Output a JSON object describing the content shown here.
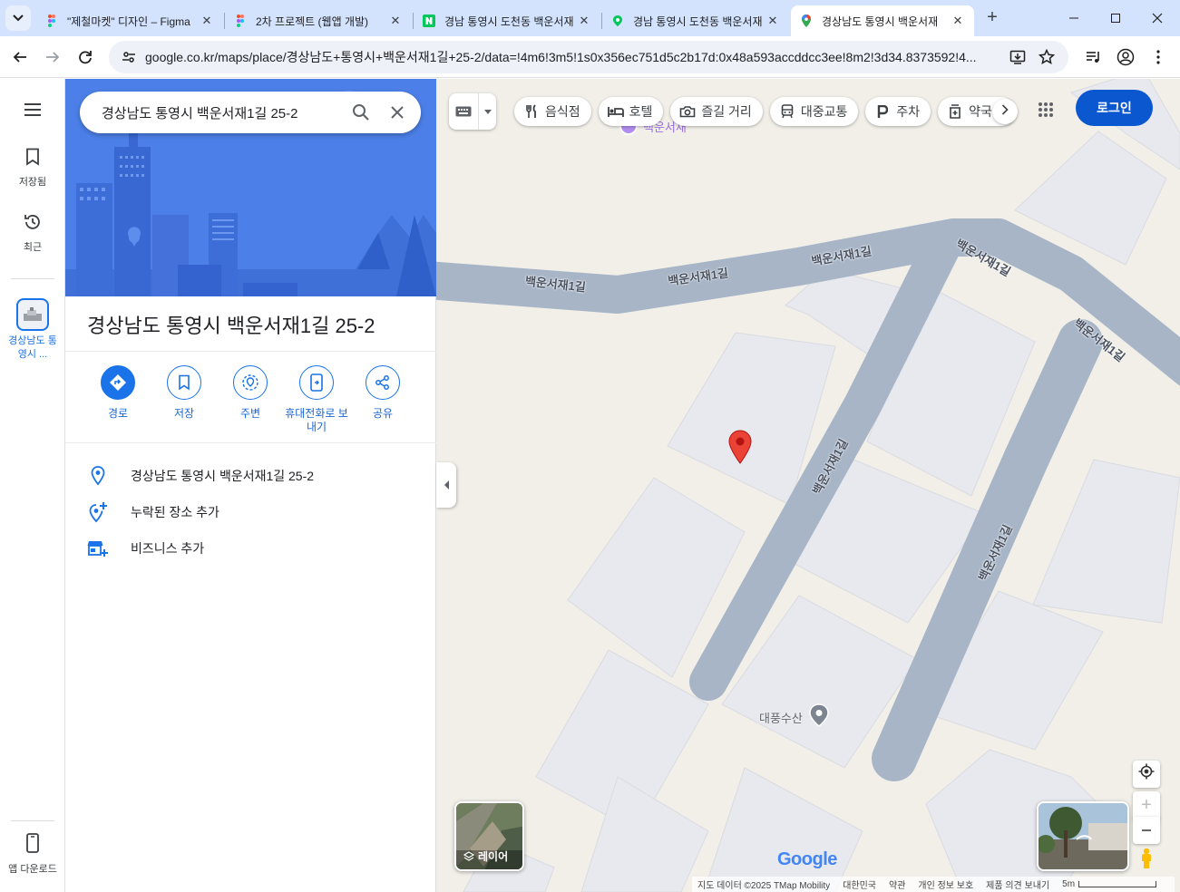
{
  "browser": {
    "tabs": [
      {
        "title": "\"제철마켓\" 디자인 – Figma",
        "favicon": "figma-icon",
        "active": false
      },
      {
        "title": "2차 프로젝트 (웹앱 개발)",
        "favicon": "figma-icon",
        "active": false
      },
      {
        "title": "경남 통영시 도천동 백운서재",
        "favicon": "naver-icon",
        "active": false
      },
      {
        "title": "경남 통영시 도천동 백운서재",
        "favicon": "naver-map-icon",
        "active": false
      },
      {
        "title": "경상남도 통영시 백운서재",
        "favicon": "google-maps-icon",
        "active": true
      }
    ],
    "new_tab_label": "+",
    "url": "google.co.kr/maps/place/경상남도+통영시+백운서재1길+25-2/data=!4m6!3m5!1s0x356ec751d5c2b17d:0x48a593accddcc3ee!8m2!3d34.8373592!4..."
  },
  "rail": {
    "menu_icon": "hamburger-icon",
    "saved_label": "저장됨",
    "recent_label": "최근",
    "recent_place_label": "경상남도 통영시 ...",
    "download_label": "앱 다운로드"
  },
  "panel": {
    "search_value": "경상남도 통영시 백운서재1길 25-2",
    "place_title": "경상남도 통영시 백운서재1길 25-2",
    "actions": [
      {
        "label": "경로",
        "icon": "directions-icon"
      },
      {
        "label": "저장",
        "icon": "bookmark-icon"
      },
      {
        "label": "주변",
        "icon": "nearby-icon"
      },
      {
        "label": "휴대전화로 보내기",
        "icon": "send-to-phone-icon"
      },
      {
        "label": "공유",
        "icon": "share-icon"
      }
    ],
    "info": [
      {
        "text": "경상남도 통영시 백운서재1길 25-2",
        "icon": "location-pin-icon"
      },
      {
        "text": "누락된 장소 추가",
        "icon": "add-place-icon"
      },
      {
        "text": "비즈니스 추가",
        "icon": "add-business-icon"
      }
    ]
  },
  "map": {
    "chips": [
      {
        "label": "음식점",
        "icon": "restaurant-icon"
      },
      {
        "label": "호텔",
        "icon": "hotel-icon"
      },
      {
        "label": "즐길 거리",
        "icon": "camera-icon"
      },
      {
        "label": "대중교통",
        "icon": "transit-icon"
      },
      {
        "label": "주차",
        "icon": "parking-icon"
      },
      {
        "label": "약국",
        "icon": "pharmacy-icon"
      }
    ],
    "login_label": "로그인",
    "road_name": "백운서재1길",
    "poi_top_label": "백운서재",
    "poi_label": "대풍수산",
    "layer_label": "레이어",
    "google_logo": "Google",
    "footer": {
      "map_data": "지도 데이터 ©2025 TMap Mobility",
      "country": "대한민국",
      "terms": "약관",
      "privacy": "개인 정보 보호",
      "feedback": "제품 의견 보내기",
      "scale": "5m"
    },
    "accent_color": "#1a73e8",
    "login_color": "#0b57d0",
    "pin_color": "#ea4335"
  }
}
